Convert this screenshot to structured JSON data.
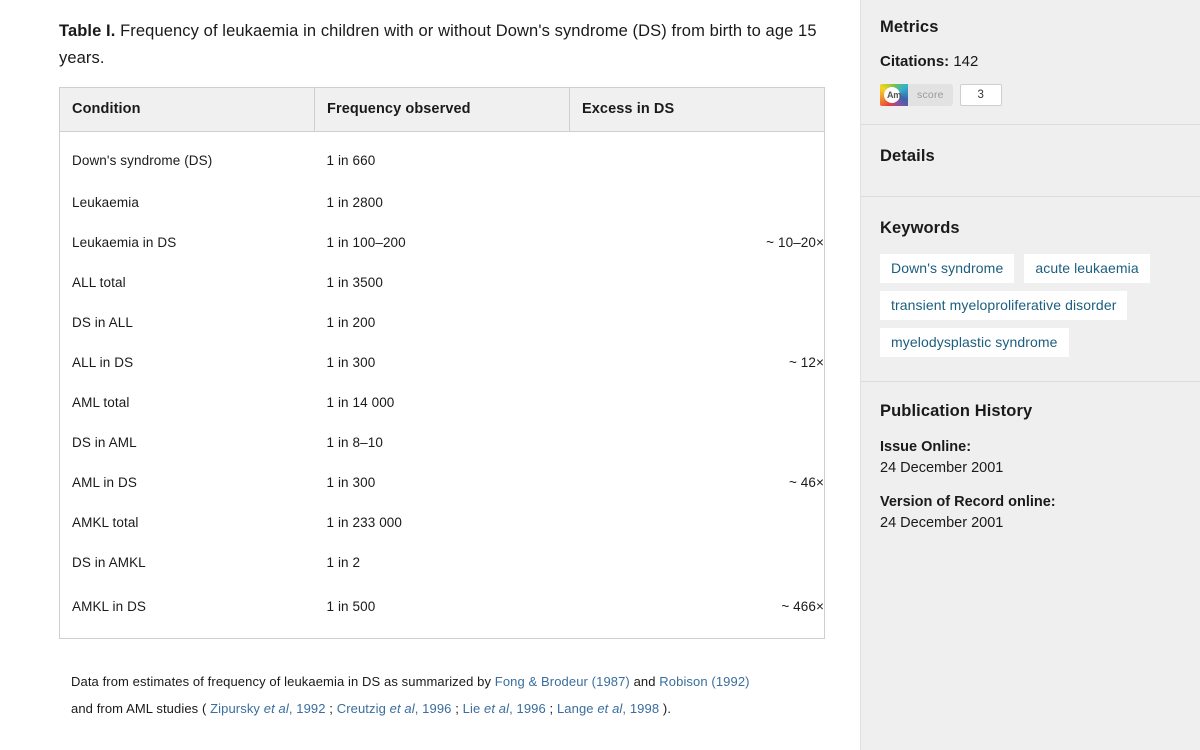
{
  "table": {
    "caption_label": "Table I.",
    "caption_text": " Frequency of leukaemia in children with or without Down's syndrome (DS) from birth to age 15 years.",
    "columns": [
      "Condition",
      "Frequency observed",
      "Excess in DS"
    ],
    "rows": [
      {
        "condition": "Down's syndrome (DS)",
        "frequency": "1 in 660",
        "excess": ""
      },
      {
        "condition": "Leukaemia",
        "frequency": "1 in 2800",
        "excess": ""
      },
      {
        "condition": "Leukaemia in DS",
        "frequency": "1 in 100–200",
        "excess": "~ 10–20×"
      },
      {
        "condition": "ALL total",
        "frequency": "1 in 3500",
        "excess": ""
      },
      {
        "condition": "DS in ALL",
        "frequency": "1 in 200",
        "excess": ""
      },
      {
        "condition": "ALL in DS",
        "frequency": "1 in 300",
        "excess": "~ 12×"
      },
      {
        "condition": "AML total",
        "frequency": "1 in 14 000",
        "excess": ""
      },
      {
        "condition": "DS in AML",
        "frequency": "1 in 8–10",
        "excess": ""
      },
      {
        "condition": "AML in DS",
        "frequency": "1 in 300",
        "excess": "~ 46×"
      },
      {
        "condition": "AMKL total",
        "frequency": "1 in 233 000",
        "excess": ""
      },
      {
        "condition": "DS in AMKL",
        "frequency": "1 in 2",
        "excess": ""
      },
      {
        "condition": "AMKL in DS",
        "frequency": "1 in 500",
        "excess": "~ 466×"
      }
    ],
    "note": {
      "line1_pre": "Data from estimates of frequency of leukaemia in DS as summarized by ",
      "link1": "Fong & Brodeur (1987)",
      "line1_mid": " and ",
      "link2": "Robison (1992)",
      "line2_pre": "and from AML studies ( ",
      "cite1_name": "Zipursky",
      "cite1_etal": "et al",
      "cite1_year": ", 1992",
      "sep1": " ; ",
      "cite2_name": "Creutzig",
      "cite2_etal": "et al",
      "cite2_year": ", 1996",
      "sep2": " ; ",
      "cite3_name": "Lie",
      "cite3_etal": "et al",
      "cite3_year": ", 1996",
      "sep3": " ; ",
      "cite4_name": "Lange",
      "cite4_etal": "et al",
      "cite4_year": ", 1998",
      "line2_end": " )."
    }
  },
  "sidebar": {
    "metrics": {
      "title": "Metrics",
      "citations_label": "Citations:",
      "citations_value": "142",
      "altmetric": {
        "logo_text": "Am",
        "score_label": "score",
        "score_value": "3"
      }
    },
    "details": {
      "title": "Details"
    },
    "keywords": {
      "title": "Keywords",
      "items": [
        "Down's syndrome",
        "acute leukaemia",
        "transient myeloproliferative disorder",
        "myelodysplastic syndrome"
      ]
    },
    "publication_history": {
      "title": "Publication History",
      "entries": [
        {
          "label": "Issue Online:",
          "value": "24 December 2001"
        },
        {
          "label": "Version of Record online:",
          "value": "24 December 2001"
        }
      ]
    }
  },
  "colors": {
    "link": "#3a6e9e",
    "keyword_text": "#1b5e7e",
    "sidebar_bg": "#efefef",
    "table_header_bg": "#f0f0f0",
    "table_border": "#cfcfcf"
  }
}
